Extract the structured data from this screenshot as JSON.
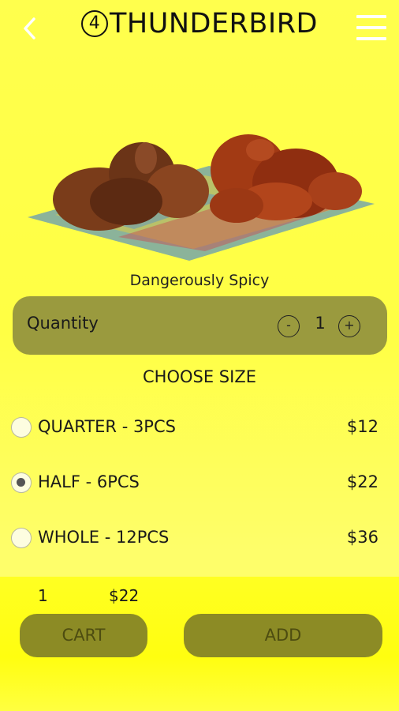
{
  "header": {
    "title_number": "4",
    "title": "THUNDERBIRD",
    "back_icon": "chevron-left-icon",
    "menu_icon": "hamburger-menu-icon"
  },
  "item": {
    "image": "fried-chicken-photo",
    "name": "Dangerously Spicy"
  },
  "quantity": {
    "label": "Quantity",
    "minus": "-",
    "value": "1",
    "plus": "+"
  },
  "sizes": {
    "heading": "CHOOSE SIZE",
    "options": [
      {
        "label": "QUARTER - 3PCS",
        "price": "$12",
        "selected": false
      },
      {
        "label": "HALF - 6PCS",
        "price": "$22",
        "selected": true
      },
      {
        "label": "WHOLE - 12PCS",
        "price": "$36",
        "selected": false
      }
    ]
  },
  "footer": {
    "quantity": "1",
    "total": "$22",
    "cart_label": "CART",
    "add_label": "ADD"
  },
  "colors": {
    "background": "#ffff44",
    "panel": "#9a9a3e",
    "button": "#8c8b25",
    "footer": "#ffff22"
  }
}
